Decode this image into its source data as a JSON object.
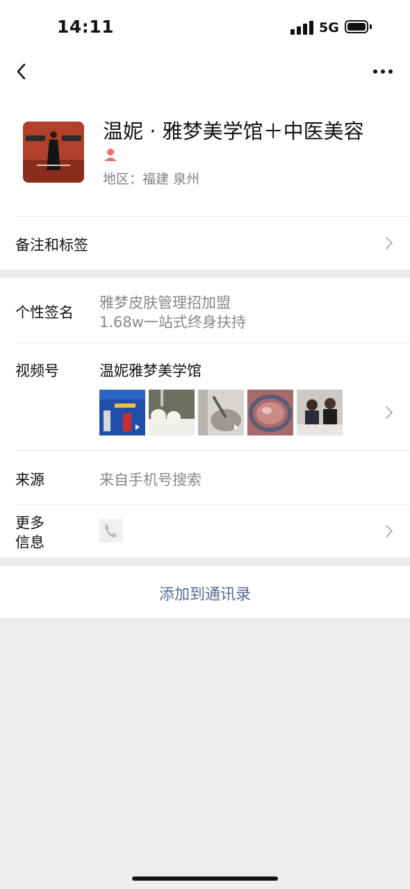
{
  "status_bar": {
    "time": "14:11",
    "network": "5G"
  },
  "profile": {
    "name": "温妮 · 雅梦美学馆＋中医美容",
    "region": "地区：福建 泉州"
  },
  "remarks_row": {
    "label": "备注和标签"
  },
  "signature_row": {
    "label": "个性签名",
    "line1": "雅梦皮肤管理招加盟",
    "line2": "1.68w一站式终身扶持"
  },
  "channels_row": {
    "label": "视频号",
    "channel_name": "温妮雅梦美学馆",
    "thumbnails": [
      "event-stage",
      "cosmetic-jars",
      "clinic-tool",
      "skin-closeup",
      "two-women"
    ]
  },
  "source_row": {
    "label": "来源",
    "value": "来自手机号搜索"
  },
  "more_info_row": {
    "label_line1": "更多",
    "label_line2": "信息"
  },
  "action": {
    "add_contact": "添加到通讯录"
  },
  "colors": {
    "link_blue": "#576b95",
    "badge_red": "#f56c6c",
    "gray_text": "#888888"
  }
}
